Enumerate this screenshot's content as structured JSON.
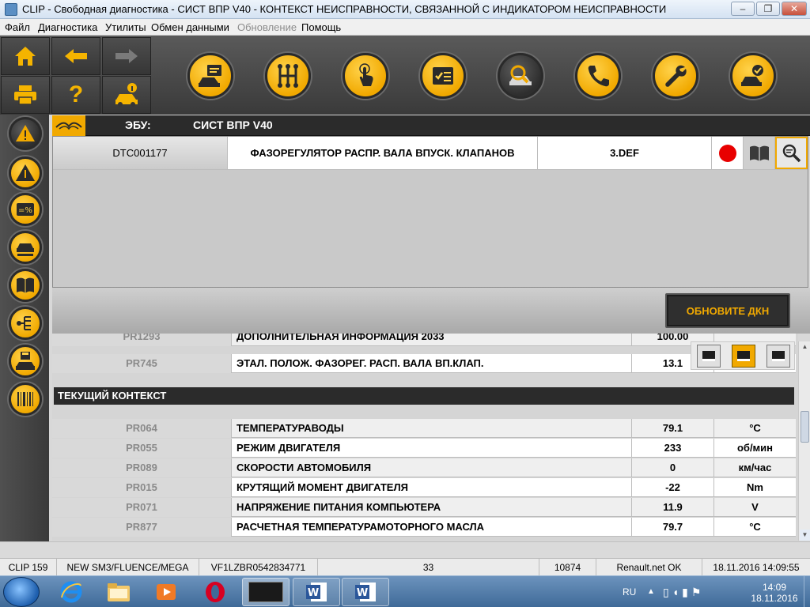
{
  "window": {
    "title": "CLIP - Свободная диагностика - СИСТ ВПР V40 - КОНТЕКСТ НЕИСПРАВНОСТИ, СВЯЗАННОЙ С ИНДИКАТОРОМ НЕИСПРАВНОСТИ",
    "minimize": "–",
    "restore": "❐",
    "close": "✕"
  },
  "menu": [
    "Файл",
    "Диагностика",
    "Утилиты",
    "Обмен данными",
    "Обновление",
    "Помощь"
  ],
  "menu_disabled_index": 4,
  "toolbar": {
    "quick": [
      "home-icon",
      "arrow-left-icon",
      "arrow-right-icon",
      "printer-icon",
      "help-icon",
      "vehicle-info-icon"
    ],
    "main": [
      "vehicle-id-icon",
      "gearbox-icon",
      "touch-icon",
      "checklist-icon",
      "fault-search-icon",
      "phone-support-icon",
      "wrench-icon",
      "vehicle-check-icon"
    ],
    "active_main": "fault-search-icon"
  },
  "sidebar": {
    "items": [
      "fault-warning-icon",
      "info-warning-icon",
      "parameters-icon",
      "vehicle-status-icon",
      "manual-book-icon",
      "wiring-icon",
      "save-vehicle-icon",
      "barcode-icon"
    ],
    "active": "fault-warning-icon"
  },
  "ecu": {
    "label": "ЭБУ:",
    "value": "СИСТ ВПР V40"
  },
  "dtc": {
    "code": "DTC001177",
    "description": "ФАЗОРЕГУЛЯТОР РАСПР. ВАЛА ВПУСК. КЛАПАНОВ",
    "type": "3.DEF",
    "status_color": "#e80000"
  },
  "refresh_button": "ОБНОВИТЕ ДКН",
  "partial_rows": [
    {
      "id": "PR1293",
      "name": "ДОПОЛНИТЕЛЬНАЯ ИНФОРМАЦИЯ 2033",
      "value": "100.00",
      "unit": ""
    },
    {
      "id": "PR745",
      "name": "ЭТАЛ. ПОЛОЖ. ФАЗОРЕГ. РАСП. ВАЛА ВП.КЛАП.",
      "value": "13.1",
      "unit": ""
    }
  ],
  "context": {
    "title": "ТЕКУЩИЙ КОНТЕКСТ",
    "rows": [
      {
        "id": "PR064",
        "name": "ТЕМПЕРАТУРАВОДЫ",
        "value": "79.1",
        "unit": "°C"
      },
      {
        "id": "PR055",
        "name": "РЕЖИМ ДВИГАТЕЛЯ",
        "value": "233",
        "unit": "об/мин"
      },
      {
        "id": "PR089",
        "name": "СКОРОСТИ АВТОМОБИЛЯ",
        "value": "0",
        "unit": "км/час"
      },
      {
        "id": "PR015",
        "name": "КРУТЯЩИЙ МОМЕНТ ДВИГАТЕЛЯ",
        "value": "-22",
        "unit": "Nm"
      },
      {
        "id": "PR071",
        "name": "НАПРЯЖЕНИЕ ПИТАНИЯ КОМПЬЮТЕРА",
        "value": "11.9",
        "unit": "V"
      },
      {
        "id": "PR877",
        "name": "РАСЧЕТНАЯ ТЕМПЕРАТУРАМОТОРНОГО МАСЛА",
        "value": "79.7",
        "unit": "°C"
      }
    ]
  },
  "statusbar": [
    "CLIP 159",
    "NEW SM3/FLUENCE/MEGA",
    "VF1LZBR0542834771",
    "33",
    "10874",
    "Renault.net OK",
    "18.11.2016 14:09:55"
  ],
  "taskbar": {
    "lang": "RU",
    "time": "14:09",
    "date": "18.11.2016",
    "apps": [
      "ie-icon",
      "explorer-icon",
      "media-player-icon",
      "opera-icon",
      "clip-icon",
      "word-icon",
      "word-icon"
    ]
  },
  "colors": {
    "accent": "#f1a900",
    "dark": "#2b2b2b"
  }
}
